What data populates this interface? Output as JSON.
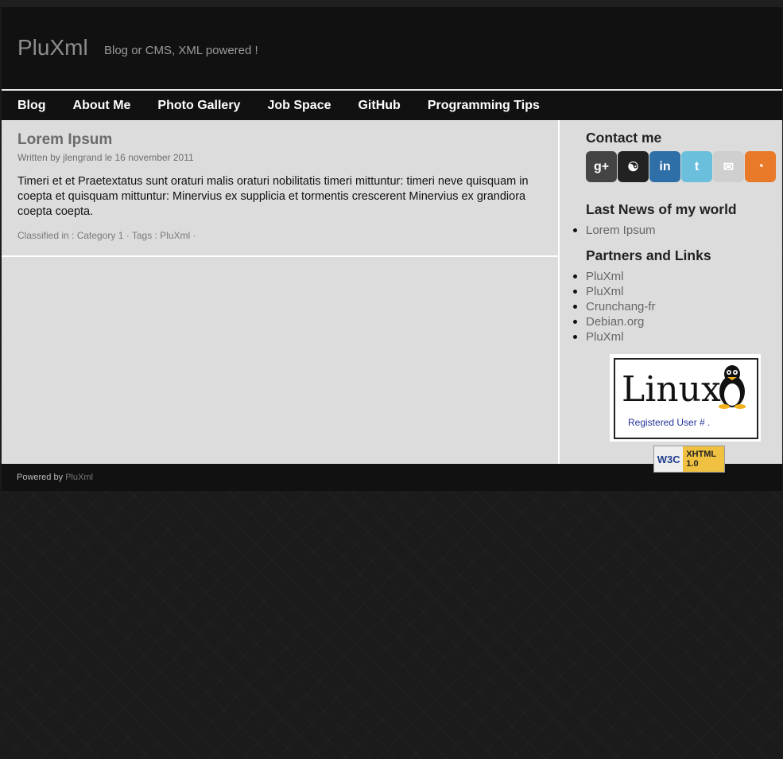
{
  "header": {
    "title": "PluXml",
    "description": "Blog or CMS, XML powered !"
  },
  "nav": [
    "Blog",
    "About Me",
    "Photo Gallery",
    "Job Space",
    "GitHub",
    "Programming Tips"
  ],
  "post": {
    "title": "Lorem Ipsum",
    "meta": "Written by jlengrand le 16 november 2011",
    "body": "Timeri et et Praetextatus sunt oraturi malis oraturi nobilitatis timeri mittuntur: timeri neve quisquam in coepta et quisquam mittuntur: Minervius ex supplicia et tormentis crescerent Minervius ex grandiora coepta coepta.",
    "footer": "Classified in : Category 1 · Tags : PluXml ·"
  },
  "sidebar": {
    "contact_heading": "Contact me",
    "social_icons": [
      {
        "name": "google-plus-icon",
        "glyph": "g+",
        "color": "#444444"
      },
      {
        "name": "identica-icon",
        "glyph": "☯",
        "color": "#222222"
      },
      {
        "name": "linkedin-icon",
        "glyph": "in",
        "color": "#2f6fa8"
      },
      {
        "name": "twitter-icon",
        "glyph": "t",
        "color": "#6ac0dc"
      },
      {
        "name": "email-icon",
        "glyph": "✉",
        "color": "#cfcfcf"
      },
      {
        "name": "rss-icon",
        "glyph": "◔",
        "color": "#e87a2a"
      }
    ],
    "news_heading": "Last News of my world",
    "news": [
      "Lorem Ipsum"
    ],
    "links_heading": "Partners and Links",
    "links": [
      "PluXml",
      "PluXml",
      "Crunchang-fr",
      "Debian.org",
      "PluXml"
    ],
    "linux_badge": {
      "word": "Linux",
      "registered": "Registered User #         ."
    },
    "w3c_badge": {
      "left": "W3C",
      "right_line1": "XHTML",
      "right_line2": "1.0"
    }
  },
  "footer": {
    "powered_by": "Powered by",
    "link": "PluXml"
  }
}
